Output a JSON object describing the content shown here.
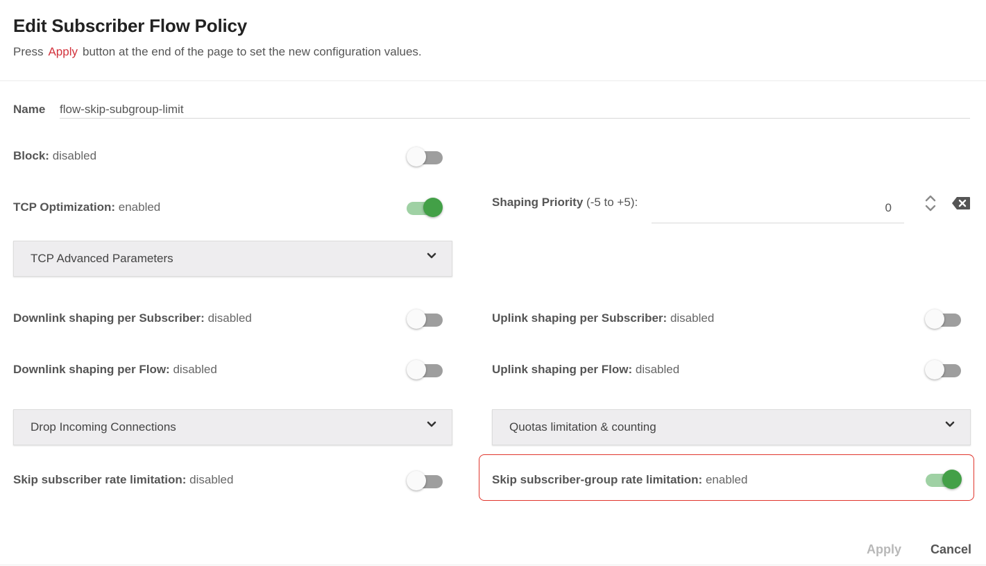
{
  "header": {
    "title": "Edit Subscriber Flow Policy",
    "subtitle_before": "Press",
    "subtitle_apply": "Apply",
    "subtitle_after": "button at the end of the page to set the new configuration values."
  },
  "name": {
    "label": "Name",
    "value": "flow-skip-subgroup-limit"
  },
  "block": {
    "label": "Block:",
    "status": "disabled",
    "enabled": false
  },
  "tcp_optimization": {
    "label": "TCP Optimization:",
    "status": "enabled",
    "enabled": true
  },
  "shaping_priority": {
    "label": "Shaping Priority",
    "range": "(-5 to +5):",
    "value": "0",
    "stepper_icon": "up-down-stepper-icon",
    "clear_icon": "backspace-clear-icon"
  },
  "panels": {
    "tcp_advanced": "TCP Advanced Parameters",
    "drop_incoming": "Drop Incoming Connections",
    "quotas": "Quotas limitation & counting"
  },
  "downlink_subscriber": {
    "label": "Downlink shaping per Subscriber:",
    "status": "disabled",
    "enabled": false
  },
  "uplink_subscriber": {
    "label": "Uplink shaping per Subscriber:",
    "status": "disabled",
    "enabled": false
  },
  "downlink_flow": {
    "label": "Downlink shaping per Flow:",
    "status": "disabled",
    "enabled": false
  },
  "uplink_flow": {
    "label": "Uplink shaping per Flow:",
    "status": "disabled",
    "enabled": false
  },
  "skip_subscriber": {
    "label": "Skip subscriber rate limitation:",
    "status": "disabled",
    "enabled": false
  },
  "skip_subscriber_group": {
    "label": "Skip subscriber-group rate limitation:",
    "status": "enabled",
    "enabled": true
  },
  "footer": {
    "apply_label": "Apply",
    "cancel_label": "Cancel"
  },
  "colors": {
    "accent_red": "#d2323c",
    "toggle_on": "#43a047",
    "toggle_on_track": "#9fd1a4",
    "toggle_off_track": "#9e9e9e",
    "highlight_border": "#e0342b"
  }
}
